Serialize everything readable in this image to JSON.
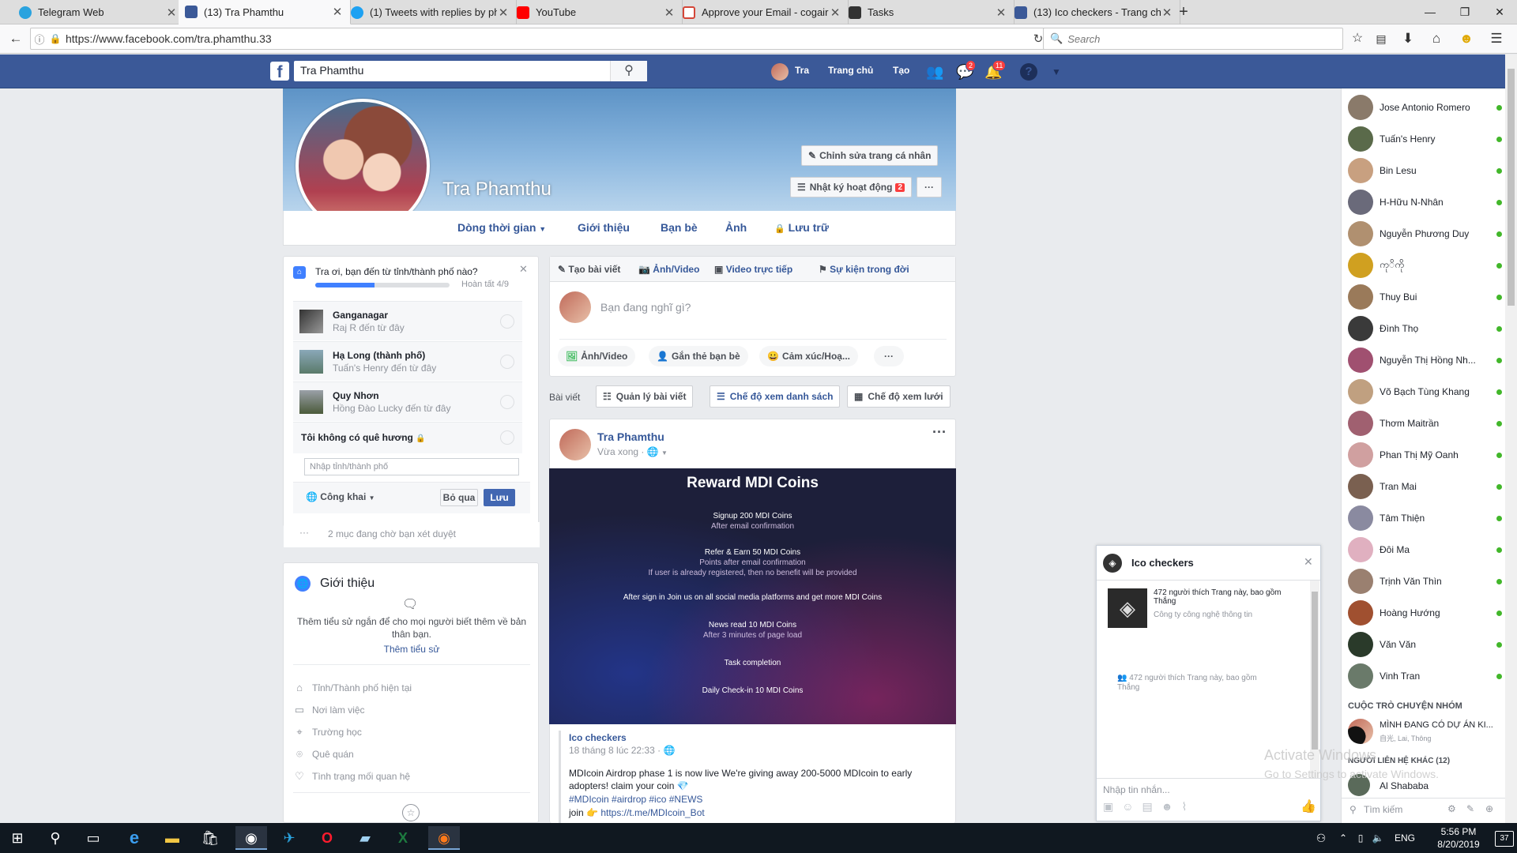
{
  "browser": {
    "tabs": [
      {
        "title": "Telegram Web",
        "color": "#2aa3df"
      },
      {
        "title": "(13) Tra Phamthu",
        "color": "#3b5998"
      },
      {
        "title": "(1) Tweets with replies by ph",
        "color": "#1da1f2"
      },
      {
        "title": "YouTube",
        "color": "#ff0000"
      },
      {
        "title": "Approve your Email - cogair",
        "color": "#d44638"
      },
      {
        "title": "Tasks",
        "color": "#333333"
      },
      {
        "title": "(13) Ico checkers - Trang chủ",
        "color": "#3b5998"
      }
    ],
    "new_tab": "+",
    "url": "https://www.facebook.com/tra.phamthu.33",
    "search_placeholder": "Search"
  },
  "fb_header": {
    "search_value": "Tra Phamthu",
    "user": "Tra",
    "home": "Trang chủ",
    "create": "Tạo",
    "messages_badge": "2",
    "notifications_badge": "11"
  },
  "profile": {
    "name": "Tra Phamthu",
    "edit_button": "Chỉnh sửa trang cá nhân",
    "activity_log": "Nhật ký hoạt động",
    "activity_badge": "2",
    "more": "···",
    "tabs": [
      "Dòng thời gian",
      "Giới thiệu",
      "Bạn bè",
      "Ảnh",
      "Lưu trữ"
    ]
  },
  "hometown_card": {
    "question": "Tra ơi, bạn đến từ tỉnh/thành phố nào?",
    "progress_text": "Hoàn tất 4/9",
    "progress": 0.44,
    "suggestions": [
      {
        "name": "Ganganagar",
        "sub": "Raj R đến từ đây"
      },
      {
        "name": "Hạ Long (thành phố)",
        "sub": "Tuấn's Henry đến từ đây"
      },
      {
        "name": "Quy Nhơn",
        "sub": "Hồng Đào Lucky đến từ đây"
      }
    ],
    "no_hometown": "Tôi không có quê hương",
    "input_placeholder": "Nhập tỉnh/thành phố",
    "privacy": "Công khai",
    "skip": "Bỏ qua",
    "save": "Lưu",
    "pending": "2 mục đang chờ bạn xét duyệt"
  },
  "intro_card": {
    "title": "Giới thiệu",
    "desc": "Thêm tiểu sử ngắn để cho mọi người biết thêm về bản thân bạn.",
    "add_bio": "Thêm tiểu sử",
    "items": [
      "Tỉnh/Thành phố hiện tại",
      "Nơi làm việc",
      "Trường học",
      "Quê quán",
      "Tình trạng mối quan hệ"
    ]
  },
  "composer": {
    "tabs": [
      "Tạo bài viết",
      "Ảnh/Video",
      "Video trực tiếp",
      "Sự kiện trong đời"
    ],
    "placeholder": "Bạn đang nghĩ gì?",
    "buttons": [
      "Ảnh/Video",
      "Gắn thẻ bạn bè",
      "Cảm xúc/Hoạ..."
    ]
  },
  "posts_bar": {
    "label": "Bài viết",
    "manage": "Quản lý bài viết",
    "list_view": "Chế độ xem danh sách",
    "grid_view": "Chế độ xem lưới"
  },
  "post": {
    "author": "Tra Phamthu",
    "time": "Vừa xong",
    "image": {
      "title": "Reward MDI Coins",
      "lines": [
        {
          "text": "Signup 200 MDI Coins",
          "note": "After email confirmation"
        },
        {
          "text": "Refer & Earn 50 MDI Coins",
          "note": "Points after email confirmation",
          "note2": "If user is already registered, then no benefit will be provided"
        },
        {
          "text": "After sign in Join us on all social media platforms and get more MDI Coins"
        },
        {
          "text": "News read 10 MDI Coins",
          "note": "After 3 minutes of page load"
        },
        {
          "text": "Task completion"
        },
        {
          "text": "Daily Check-in 10 MDI Coins"
        }
      ]
    },
    "shared_from": "Ico checkers",
    "shared_time": "18 tháng 8 lúc 22:33",
    "text1": "MDIcoin Airdrop phase 1 is now live We're giving away 200-5000 MDIcoin to early adopters! claim your coin",
    "hashtags": "#MDIcoin #airdrop #ico #NEWS",
    "join": "join 👉",
    "join_link": "https://t.me/MDIcoin_Bot"
  },
  "chat_window": {
    "title": "Ico checkers",
    "likes": "472 người thích Trang này, bao gồm Thắng",
    "category": "Công ty công nghệ thông tin",
    "likes2": "472 người thích Trang này, bao gồm Thắng",
    "input_placeholder": "Nhập tin nhắn..."
  },
  "contacts": [
    {
      "name": "Jose Antonio Romero",
      "color": "#8a7a6a"
    },
    {
      "name": "Tuấn's Henry",
      "color": "#5a6a4a"
    },
    {
      "name": "Bin Lesu",
      "color": "#c8a080"
    },
    {
      "name": "H-Hữu N-Nhân",
      "color": "#6a6a7a"
    },
    {
      "name": "Nguyễn Phương Duy",
      "color": "#b09070"
    },
    {
      "name": "ကုိကို",
      "color": "#d0a020"
    },
    {
      "name": "Thuy Bui",
      "color": "#9a7a5a"
    },
    {
      "name": "Đình Thọ",
      "color": "#3a3a3a"
    },
    {
      "name": "Nguyễn Thị Hồng Nh...",
      "color": "#a05070"
    },
    {
      "name": "Võ Bạch Tùng Khang",
      "color": "#c0a080"
    },
    {
      "name": "Thơm Maitrần",
      "color": "#a06070"
    },
    {
      "name": "Phan Thị Mỹ Oanh",
      "color": "#d0a0a0"
    },
    {
      "name": "Tran Mai",
      "color": "#7a6050"
    },
    {
      "name": "Tâm Thiện",
      "color": "#8a8aa0"
    },
    {
      "name": "Đôi Ma",
      "color": "#e0b0c0"
    },
    {
      "name": "Trịnh Văn Thìn",
      "color": "#9a8070"
    },
    {
      "name": "Hoàng Hướng",
      "color": "#a05030"
    },
    {
      "name": "Văn Văn",
      "color": "#2a3a2a"
    },
    {
      "name": "Vinh Tran",
      "color": "#6a7a6a"
    }
  ],
  "group_section": {
    "title": "CUỘC TRÒ CHUYỆN NHÓM",
    "group_name": "MÌNH ĐANG CÓ DỰ ÁN KI...",
    "group_members": "自光, Lai, Thông",
    "other_title": "NGƯỜI LIÊN HỆ KHÁC (12)",
    "other_contact": "Al Shababa",
    "search": "Tìm kiếm"
  },
  "watermark": {
    "line1": "Activate Windows",
    "line2": "Go to Settings to activate Windows."
  },
  "taskbar": {
    "lang": "ENG",
    "time": "5:56 PM",
    "date": "8/20/2019",
    "notif": "37"
  }
}
